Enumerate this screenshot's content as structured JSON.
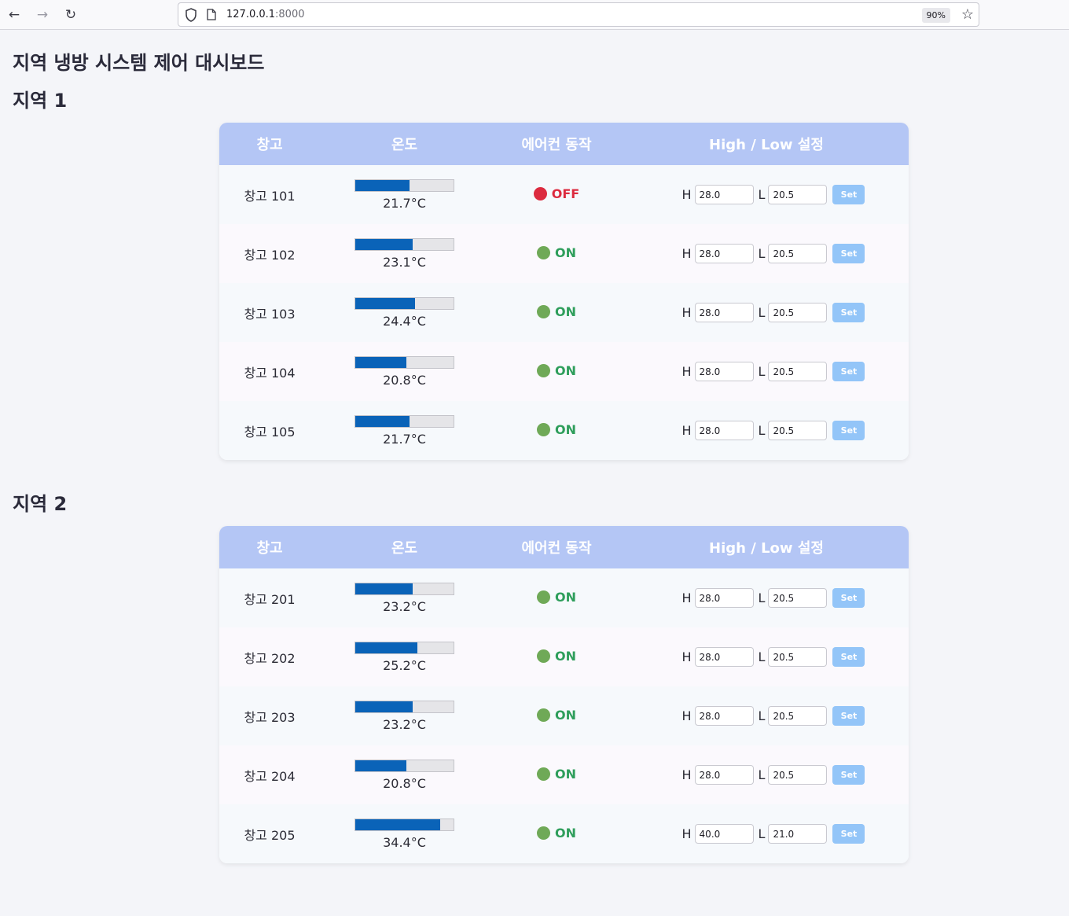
{
  "browser": {
    "url_host": "127.0.0.1",
    "url_port": ":8000",
    "zoom": "90%"
  },
  "page": {
    "title": "지역 냉방 시스템 제어 대시보드"
  },
  "table_headers": {
    "warehouse": "창고",
    "temperature": "온도",
    "ac_status": "에어컨 동작",
    "setting": "High / Low 설정"
  },
  "labels": {
    "high": "H",
    "low": "L",
    "set_button": "Set"
  },
  "colors": {
    "header_bg": "#b4c6f5",
    "bar_fill": "#0a63b8",
    "on_color": "#2e9e5b",
    "on_dot": "#6fa957",
    "off_color": "#dc2b3f",
    "set_button_bg": "#93c5f8"
  },
  "regions": [
    {
      "title": "지역 1",
      "rows": [
        {
          "name": "창고 101",
          "temp": "21.7°C",
          "temp_fraction": 0.55,
          "ac": "OFF",
          "ac_state": "off",
          "high": "28.0",
          "low": "20.5"
        },
        {
          "name": "창고 102",
          "temp": "23.1°C",
          "temp_fraction": 0.58,
          "ac": "ON",
          "ac_state": "on",
          "high": "28.0",
          "low": "20.5"
        },
        {
          "name": "창고 103",
          "temp": "24.4°C",
          "temp_fraction": 0.61,
          "ac": "ON",
          "ac_state": "on",
          "high": "28.0",
          "low": "20.5"
        },
        {
          "name": "창고 104",
          "temp": "20.8°C",
          "temp_fraction": 0.52,
          "ac": "ON",
          "ac_state": "on",
          "high": "28.0",
          "low": "20.5"
        },
        {
          "name": "창고 105",
          "temp": "21.7°C",
          "temp_fraction": 0.55,
          "ac": "ON",
          "ac_state": "on",
          "high": "28.0",
          "low": "20.5"
        }
      ]
    },
    {
      "title": "지역 2",
      "rows": [
        {
          "name": "창고 201",
          "temp": "23.2°C",
          "temp_fraction": 0.58,
          "ac": "ON",
          "ac_state": "on",
          "high": "28.0",
          "low": "20.5"
        },
        {
          "name": "창고 202",
          "temp": "25.2°C",
          "temp_fraction": 0.63,
          "ac": "ON",
          "ac_state": "on",
          "high": "28.0",
          "low": "20.5"
        },
        {
          "name": "창고 203",
          "temp": "23.2°C",
          "temp_fraction": 0.58,
          "ac": "ON",
          "ac_state": "on",
          "high": "28.0",
          "low": "20.5"
        },
        {
          "name": "창고 204",
          "temp": "20.8°C",
          "temp_fraction": 0.52,
          "ac": "ON",
          "ac_state": "on",
          "high": "28.0",
          "low": "20.5"
        },
        {
          "name": "창고 205",
          "temp": "34.4°C",
          "temp_fraction": 0.86,
          "ac": "ON",
          "ac_state": "on",
          "high": "40.0",
          "low": "21.0"
        }
      ]
    }
  ]
}
